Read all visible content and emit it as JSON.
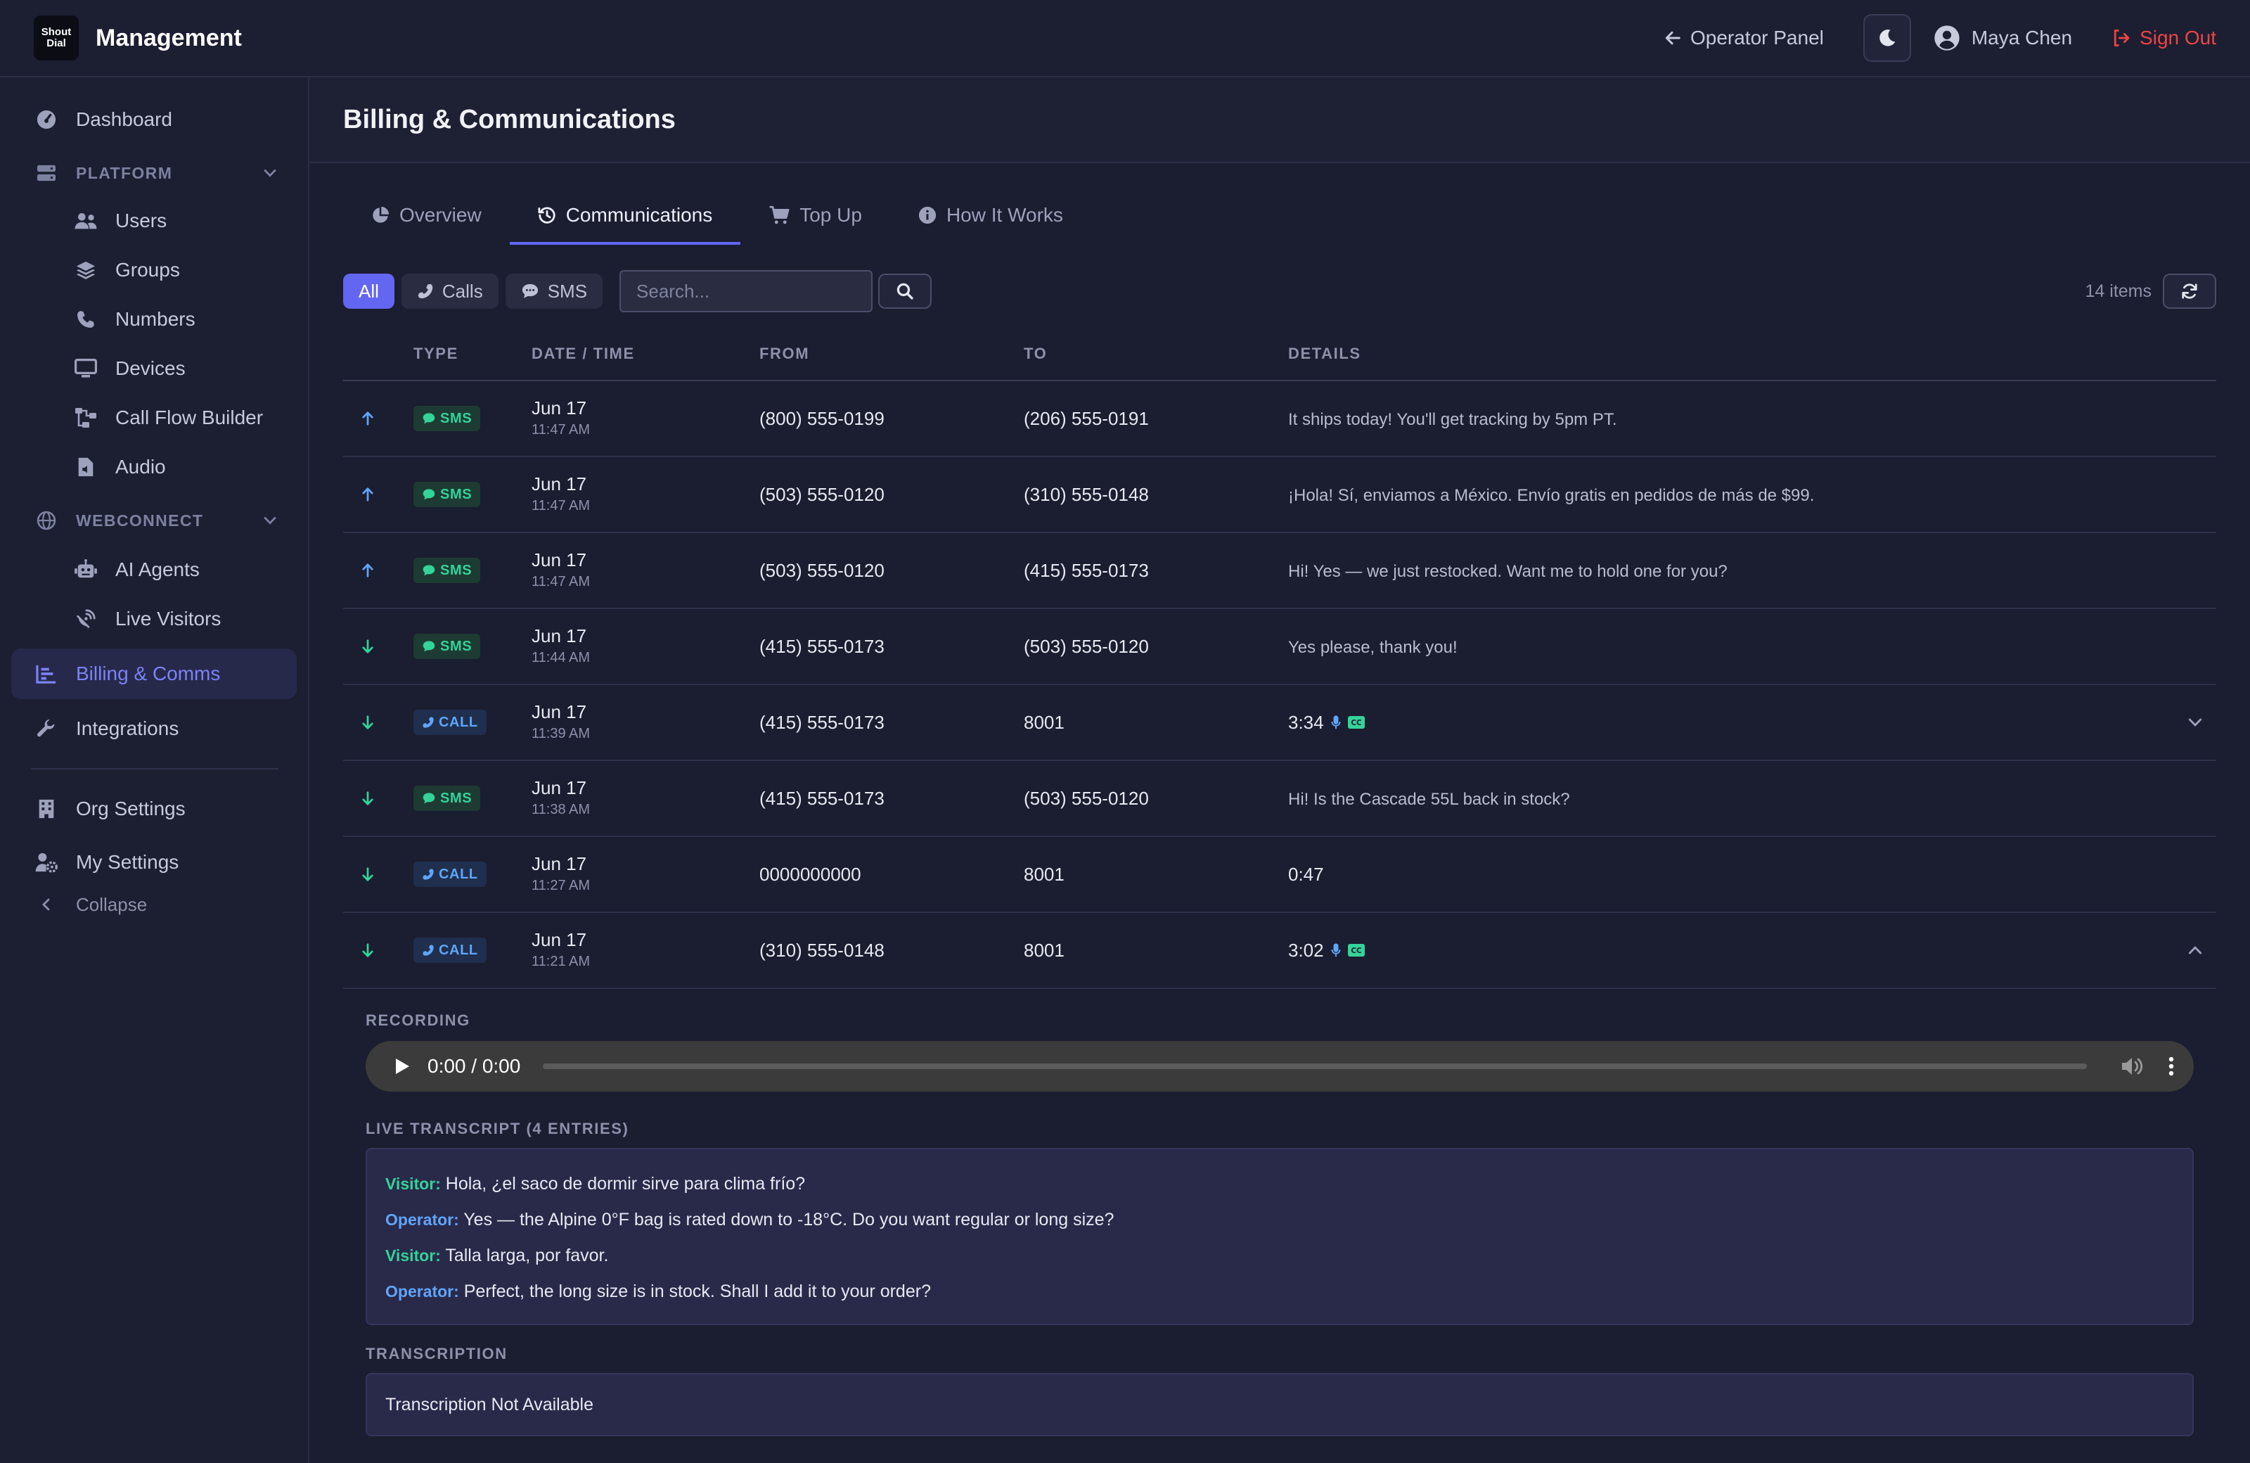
{
  "topbar": {
    "logo_line1": "Shout",
    "logo_line2": "Dial",
    "title": "Management",
    "operator_panel": "Operator Panel",
    "user_name": "Maya Chen",
    "sign_out": "Sign Out"
  },
  "sidebar": {
    "dashboard": "Dashboard",
    "platform_section": "PLATFORM",
    "platform_items": [
      "Users",
      "Groups",
      "Numbers",
      "Devices",
      "Call Flow Builder",
      "Audio"
    ],
    "webconnect_section": "WEBCONNECT",
    "webconnect_items": [
      "AI Agents",
      "Live Visitors"
    ],
    "billing": "Billing & Comms",
    "integrations": "Integrations",
    "org_settings": "Org Settings",
    "my_settings": "My Settings",
    "collapse": "Collapse"
  },
  "page": {
    "title": "Billing & Communications"
  },
  "tabs": [
    "Overview",
    "Communications",
    "Top Up",
    "How It Works"
  ],
  "filters": {
    "all": "All",
    "calls": "Calls",
    "sms": "SMS",
    "search_placeholder": "Search...",
    "items_count": "14 items"
  },
  "table": {
    "headers": [
      "TYPE",
      "DATE / TIME",
      "FROM",
      "TO",
      "DETAILS"
    ],
    "rows": [
      {
        "dir": "out",
        "type": "SMS",
        "date": "Jun 17",
        "time": "11:47 AM",
        "from": "(800) 555-0199",
        "to": "(206) 555-0191",
        "details": "It ships today! You'll get tracking by 5pm PT."
      },
      {
        "dir": "out",
        "type": "SMS",
        "date": "Jun 17",
        "time": "11:47 AM",
        "from": "(503) 555-0120",
        "to": "(310) 555-0148",
        "details": "¡Hola! Sí, enviamos a México. Envío gratis en pedidos de más de $99."
      },
      {
        "dir": "out",
        "type": "SMS",
        "date": "Jun 17",
        "time": "11:47 AM",
        "from": "(503) 555-0120",
        "to": "(415) 555-0173",
        "details": "Hi! Yes — we just restocked. Want me to hold one for you?"
      },
      {
        "dir": "in",
        "type": "SMS",
        "date": "Jun 17",
        "time": "11:44 AM",
        "from": "(415) 555-0173",
        "to": "(503) 555-0120",
        "details": "Yes please, thank you!"
      },
      {
        "dir": "in",
        "type": "CALL",
        "date": "Jun 17",
        "time": "11:39 AM",
        "from": "(415) 555-0173",
        "to": "8001",
        "details": "3:34",
        "media": true,
        "expand": "down"
      },
      {
        "dir": "in",
        "type": "SMS",
        "date": "Jun 17",
        "time": "11:38 AM",
        "from": "(415) 555-0173",
        "to": "(503) 555-0120",
        "details": "Hi! Is the Cascade 55L back in stock?"
      },
      {
        "dir": "in",
        "type": "CALL",
        "date": "Jun 17",
        "time": "11:27 AM",
        "from": "0000000000",
        "to": "8001",
        "details": "0:47"
      },
      {
        "dir": "in",
        "type": "CALL",
        "date": "Jun 17",
        "time": "11:21 AM",
        "from": "(310) 555-0148",
        "to": "8001",
        "details": "3:02",
        "media": true,
        "expand": "up"
      }
    ]
  },
  "expanded": {
    "recording_label": "RECORDING",
    "player_time": "0:00 / 0:00",
    "transcript_label": "LIVE TRANSCRIPT (4 ENTRIES)",
    "transcript": [
      {
        "speaker": "Visitor:",
        "role": "visitor",
        "text": "Hola, ¿el saco de dormir sirve para clima frío?"
      },
      {
        "speaker": "Operator:",
        "role": "operator",
        "text": "Yes — the Alpine 0°F bag is rated down to -18°C. Do you want regular or long size?"
      },
      {
        "speaker": "Visitor:",
        "role": "visitor",
        "text": "Talla larga, por favor."
      },
      {
        "speaker": "Operator:",
        "role": "operator",
        "text": "Perfect, the long size is in stock. Shall I add it to your order?"
      }
    ],
    "transcription_label": "TRANSCRIPTION",
    "transcription_value": "Transcription Not Available"
  },
  "colors": {
    "accent": "#6366f1",
    "sms_green": "#34d399",
    "call_blue": "#60a5fa",
    "danger": "#ef4444"
  }
}
